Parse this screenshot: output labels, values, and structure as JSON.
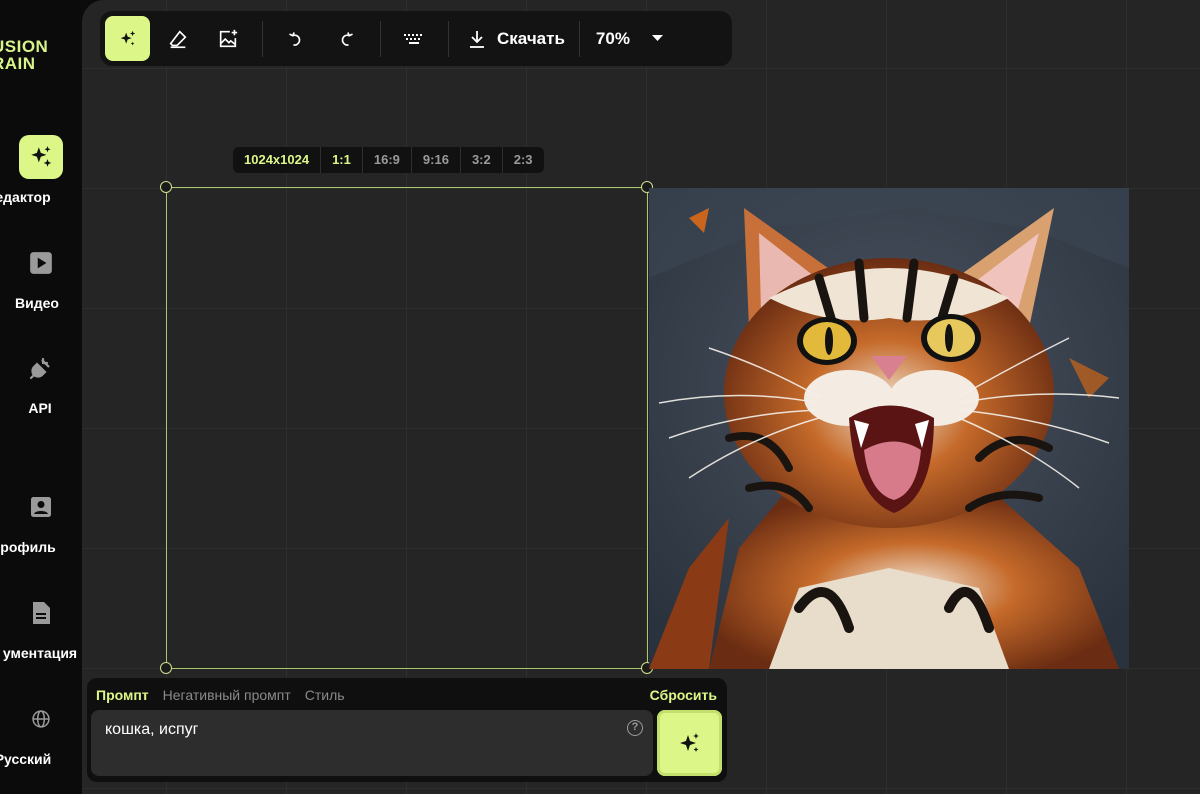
{
  "app": {
    "logo_line1": "USION",
    "logo_line2": "RAIN"
  },
  "sidebar": {
    "items": [
      {
        "label": "едактор",
        "icon": "sparkles-icon",
        "active": true
      },
      {
        "label": "Видео",
        "icon": "play-icon"
      },
      {
        "label": "API",
        "icon": "plug-icon"
      },
      {
        "label": "рофиль",
        "icon": "profile-icon"
      },
      {
        "label": "ументация",
        "icon": "document-icon"
      },
      {
        "label": "Русский",
        "icon": "globe-icon"
      }
    ]
  },
  "toolbar": {
    "download_label": "Скачать",
    "zoom": "70%"
  },
  "aspect": {
    "size": "1024x1024",
    "ratios": [
      "1:1",
      "16:9",
      "9:16",
      "3:2",
      "2:3"
    ],
    "selected": "1:1"
  },
  "prompt": {
    "tabs": [
      "Промпт",
      "Негативный промпт",
      "Стиль"
    ],
    "active_tab": "Промпт",
    "reset_label": "Сбросить",
    "value": "кошка, испуг",
    "help": "?"
  },
  "colors": {
    "accent": "#dcf788",
    "canvas": "#252525",
    "panel": "#0f0f0f"
  }
}
